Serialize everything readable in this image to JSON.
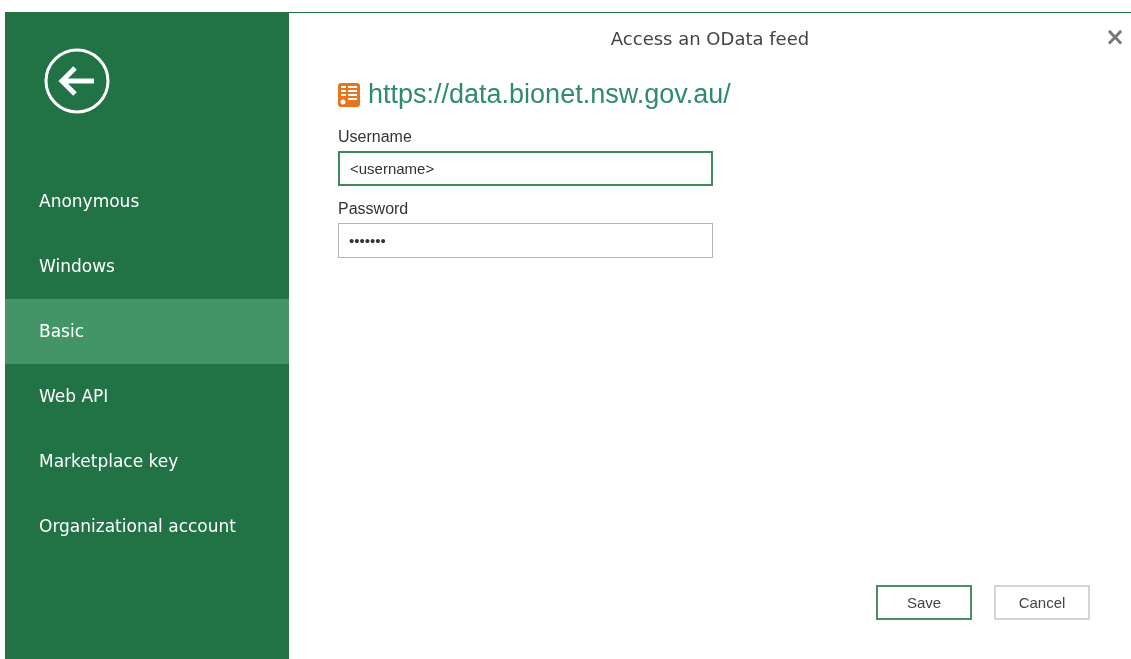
{
  "window": {
    "title": "Access an OData feed",
    "close": "×"
  },
  "sidebar": {
    "items": [
      {
        "label": "Anonymous",
        "selected": false
      },
      {
        "label": "Windows",
        "selected": false
      },
      {
        "label": "Basic",
        "selected": true
      },
      {
        "label": "Web API",
        "selected": false
      },
      {
        "label": "Marketplace key",
        "selected": false
      },
      {
        "label": "Organizational account",
        "selected": false
      }
    ]
  },
  "url": "https://data.bionet.nsw.gov.au/",
  "fields": [
    {
      "label": "Username",
      "value": "<username>",
      "focused": true
    },
    {
      "label": "Password",
      "value": "•••••••",
      "focused": false
    }
  ],
  "buttons": [
    {
      "label": "Save",
      "default": true
    },
    {
      "label": "Cancel",
      "default": false
    }
  ]
}
